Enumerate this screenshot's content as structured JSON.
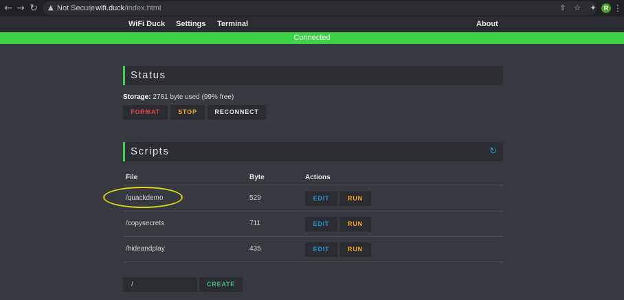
{
  "browser": {
    "back_icon": "arrow-left-icon",
    "forward_icon": "arrow-right-icon",
    "reload_icon": "reload-icon",
    "security_label": "Not Secure",
    "url_host": "wifi.duck",
    "url_path": "/index.html",
    "profile_initial": "R"
  },
  "nav": {
    "brand": "WiFi Duck",
    "settings": "Settings",
    "terminal": "Terminal",
    "about": "About"
  },
  "status_bar": {
    "text": "Connected",
    "color": "#3fd247"
  },
  "status_section": {
    "title": "Status",
    "storage_label": "Storage:",
    "storage_value": "2761 byte used (99% free)",
    "buttons": {
      "format": "format",
      "stop": "stop",
      "reconnect": "reconnect"
    }
  },
  "scripts_section": {
    "title": "Scripts",
    "refresh_icon": "refresh-icon",
    "columns": {
      "file": "File",
      "byte": "Byte",
      "actions": "Actions"
    },
    "rows": [
      {
        "file": "/quackdemo",
        "byte": "529",
        "edit": "edit",
        "run": "run"
      },
      {
        "file": "/copysecrets",
        "byte": "711",
        "edit": "edit",
        "run": "run"
      },
      {
        "file": "/hideandplay",
        "byte": "435",
        "edit": "edit",
        "run": "run"
      }
    ],
    "new_file_value": "/",
    "create_label": "create"
  },
  "colors": {
    "accent_green": "#3fd247",
    "format_red": "#e8454f",
    "stop_orange": "#f5a623",
    "edit_blue": "#2b96d4",
    "create_teal": "#3fbf8a",
    "highlight_yellow": "#e2d21a"
  }
}
